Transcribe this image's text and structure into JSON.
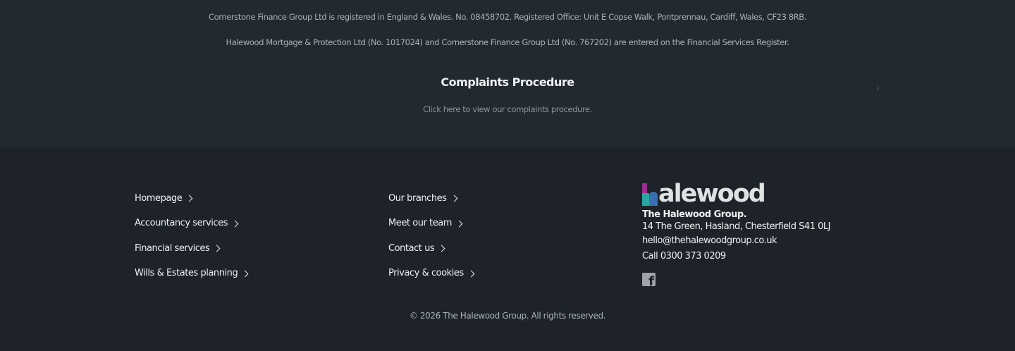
{
  "regulatory": {
    "line1": "Cornerstone Finance Group Ltd is registered in England & Wales. No. 08458702. Registered Office: Unit E Copse Walk, Pontprennau, Cardiff, Wales, CF23 8RB.",
    "line2": "Halewood Mortgage & Protection Ltd (No. 1017024) and Cornerstone Finance Group Ltd (No. 767202) are entered on the Financial Services Register."
  },
  "complaints": {
    "title": "Complaints Procedure",
    "link": "Click here to view our complaints procedure.",
    "arrow": "›"
  },
  "footer_nav": {
    "col1": [
      {
        "label": "Homepage"
      },
      {
        "label": "Accountancy services"
      },
      {
        "label": "Financial services"
      },
      {
        "label": "Wills & Estates planning"
      }
    ],
    "col2": [
      {
        "label": "Our branches"
      },
      {
        "label": "Meet our team"
      },
      {
        "label": "Contact us"
      },
      {
        "label": "Privacy & cookies"
      }
    ]
  },
  "brand": {
    "logo_text": "alewood",
    "logo_full": "halewood",
    "company": "The Halewood Group.",
    "address": "14 The Green, Hasland, Chesterfield S41 0LJ",
    "email": "hello@thehalewoodgroup.co.uk",
    "phone": "Call 0300 373 0209",
    "social_icon": "facebook-icon",
    "colors": {
      "purple": "#9b2f8f",
      "teal": "#2aa6a0",
      "blue": "#3b6fb3"
    }
  },
  "copyright": "© 2026 The Halewood Group. All rights reserved."
}
